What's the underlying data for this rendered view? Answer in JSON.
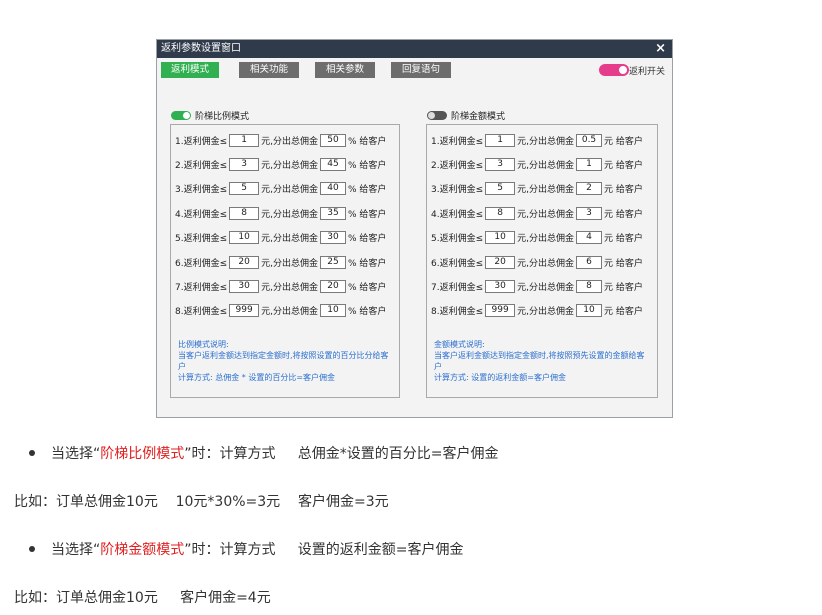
{
  "window": {
    "title": "返利参数设置窗口",
    "close_glyph": "×"
  },
  "tabs": [
    "返利模式",
    "相关功能",
    "相关参数",
    "回复语句"
  ],
  "master_switch": {
    "label": "返利开关",
    "state": "on",
    "color": "#e63c8c"
  },
  "ratio_mode": {
    "label": "阶梯比例模式",
    "state": "on",
    "rows": [
      {
        "prefix": "1.返利佣金≤",
        "amount": "1",
        "mid": "元,分出总佣金",
        "value": "50",
        "suffix": "% 给客户"
      },
      {
        "prefix": "2.返利佣金≤",
        "amount": "3",
        "mid": "元,分出总佣金",
        "value": "45",
        "suffix": "% 给客户"
      },
      {
        "prefix": "3.返利佣金≤",
        "amount": "5",
        "mid": "元,分出总佣金",
        "value": "40",
        "suffix": "% 给客户"
      },
      {
        "prefix": "4.返利佣金≤",
        "amount": "8",
        "mid": "元,分出总佣金",
        "value": "35",
        "suffix": "% 给客户"
      },
      {
        "prefix": "5.返利佣金≤",
        "amount": "10",
        "mid": "元,分出总佣金",
        "value": "30",
        "suffix": "% 给客户"
      },
      {
        "prefix": "6.返利佣金≤",
        "amount": "20",
        "mid": "元,分出总佣金",
        "value": "25",
        "suffix": "% 给客户"
      },
      {
        "prefix": "7.返利佣金≤",
        "amount": "30",
        "mid": "元,分出总佣金",
        "value": "20",
        "suffix": "% 给客户"
      },
      {
        "prefix": "8.返利佣金≤",
        "amount": "999",
        "mid": "元,分出总佣金",
        "value": "10",
        "suffix": "% 给客户"
      }
    ],
    "desc": {
      "title": "比例模式说明:",
      "line1": "当客户返利金额达到指定金额时,将按照设置的百分比分给客户",
      "line2": "计算方式:   总佣金 * 设置的百分比=客户佣金"
    }
  },
  "amount_mode": {
    "label": "阶梯金额模式",
    "state": "off",
    "rows": [
      {
        "prefix": "1.返利佣金≤",
        "amount": "1",
        "mid": "元,分出总佣金",
        "value": "0.5",
        "suffix": "元 给客户"
      },
      {
        "prefix": "2.返利佣金≤",
        "amount": "3",
        "mid": "元,分出总佣金",
        "value": "1",
        "suffix": "元 给客户"
      },
      {
        "prefix": "3.返利佣金≤",
        "amount": "5",
        "mid": "元,分出总佣金",
        "value": "2",
        "suffix": "元 给客户"
      },
      {
        "prefix": "4.返利佣金≤",
        "amount": "8",
        "mid": "元,分出总佣金",
        "value": "3",
        "suffix": "元 给客户"
      },
      {
        "prefix": "5.返利佣金≤",
        "amount": "10",
        "mid": "元,分出总佣金",
        "value": "4",
        "suffix": "元 给客户"
      },
      {
        "prefix": "6.返利佣金≤",
        "amount": "20",
        "mid": "元,分出总佣金",
        "value": "6",
        "suffix": "元 给客户"
      },
      {
        "prefix": "7.返利佣金≤",
        "amount": "30",
        "mid": "元,分出总佣金",
        "value": "8",
        "suffix": "元 给客户"
      },
      {
        "prefix": "8.返利佣金≤",
        "amount": "999",
        "mid": "元,分出总佣金",
        "value": "10",
        "suffix": "元 给客户"
      }
    ],
    "desc": {
      "title": "金额模式说明:",
      "line1": "当客户返利金额达到指定金额时,将按照预先设置的金额给客户",
      "line2": "计算方式:   设置的返利金额=客户佣金"
    }
  },
  "article": {
    "bullet1": {
      "pre": "当选择“",
      "highlight": "阶梯比例模式",
      "post": "”时：计算方式     总佣金*设置的百分比=客户佣金"
    },
    "example1": "比如：订单总佣金10元    10元*30%=3元    客户佣金=3元",
    "bullet2": {
      "pre": "当选择“",
      "highlight": "阶梯金额模式",
      "post": "”时：计算方式     设置的返利金额=客户佣金"
    },
    "example2": "比如：订单总佣金10元     客户佣金=4元"
  },
  "colors": {
    "highlight": "#e02020",
    "desc_text": "#2a6fd0",
    "tab_active": "#30b050",
    "titlebar": "#2f3a4a"
  }
}
